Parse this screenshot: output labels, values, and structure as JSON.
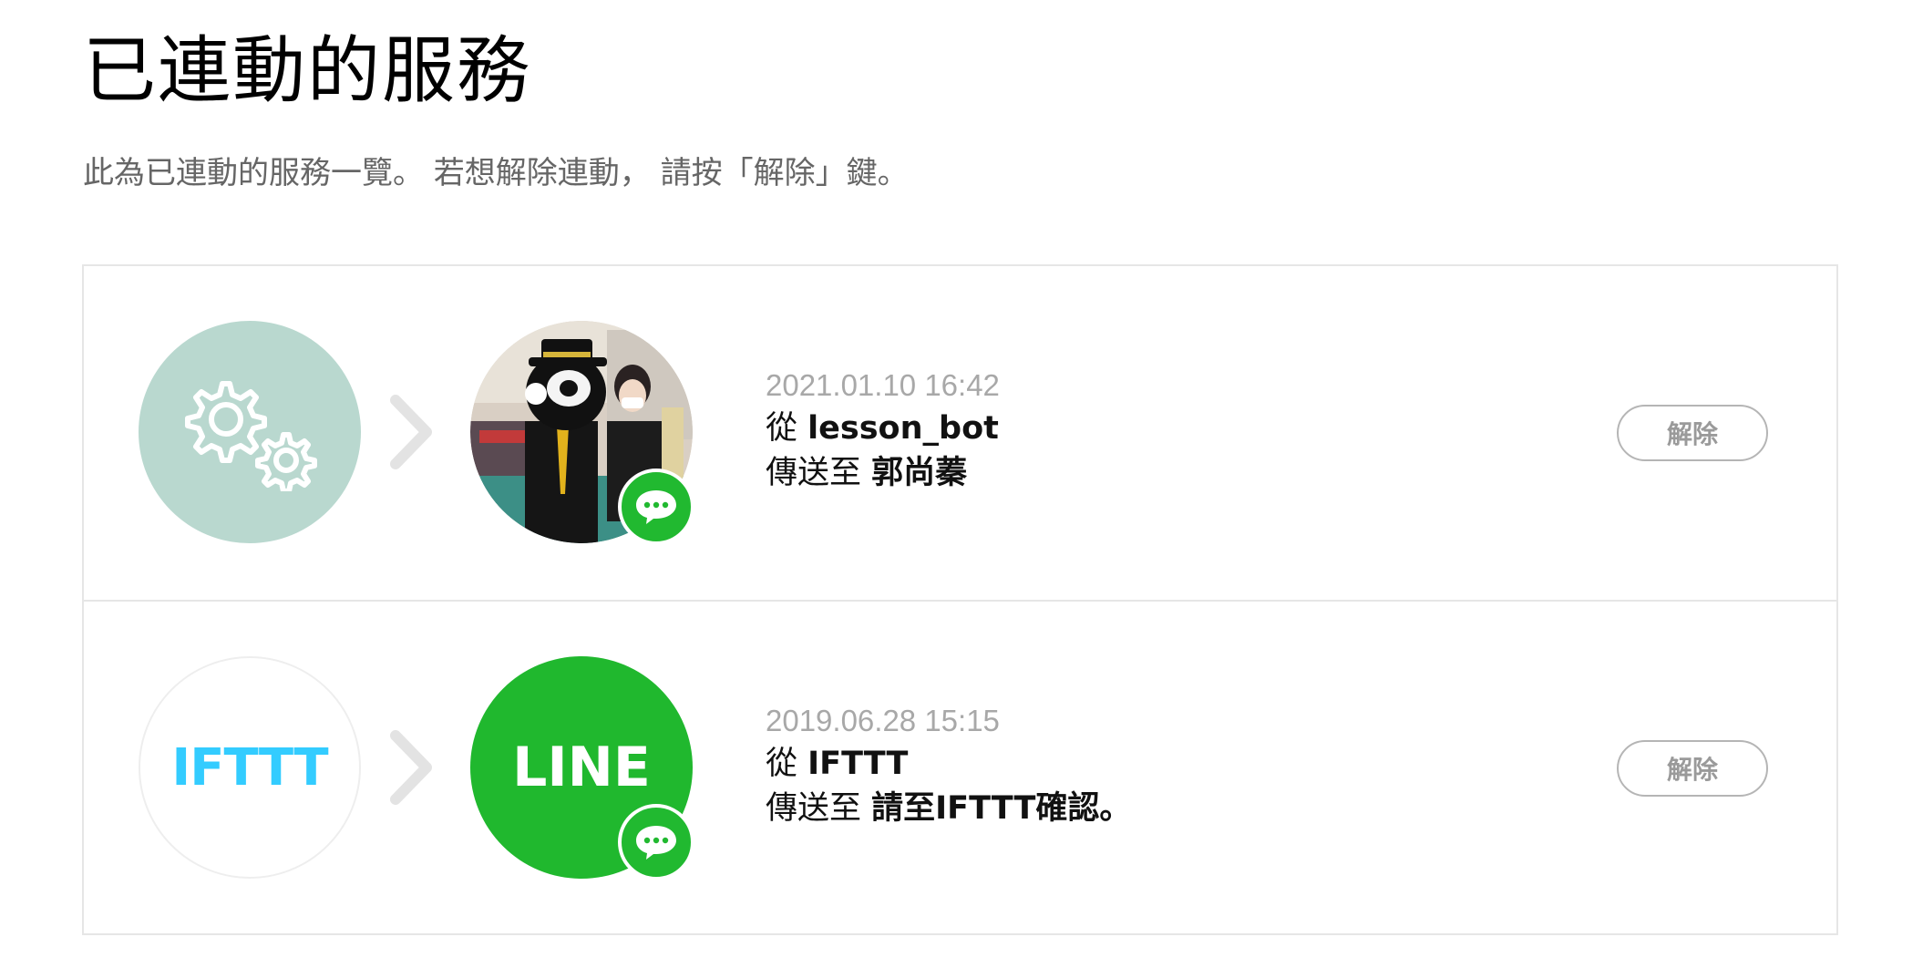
{
  "page": {
    "title": "已連動的服務",
    "description": "此為已連動的服務一覽。 若想解除連動， 請按「解除」鍵。"
  },
  "services": [
    {
      "source_icon": "gears-icon",
      "target_icon": "profile-photo",
      "date": "2021.01.10 16:42",
      "from_prefix": "從",
      "from_name": "lesson_bot",
      "to_prefix": "傳送至",
      "to_name": "郭尚蓁",
      "unlink_label": "解除"
    },
    {
      "source_icon": "ifttt-logo",
      "source_logo_text": "IFTTT",
      "target_icon": "line-logo",
      "target_logo_text": "LINE",
      "date": "2019.06.28 15:15",
      "from_prefix": "從",
      "from_name": "IFTTT",
      "to_prefix": "傳送至",
      "to_name": "請至IFTTT確認。",
      "unlink_label": "解除"
    }
  ],
  "colors": {
    "gears_bg": "#b9d8cf",
    "line_green": "#20b82e",
    "ifttt_blue": "#33ccff",
    "date_gray": "#a8a8a8",
    "button_border": "#b5b5b5"
  }
}
